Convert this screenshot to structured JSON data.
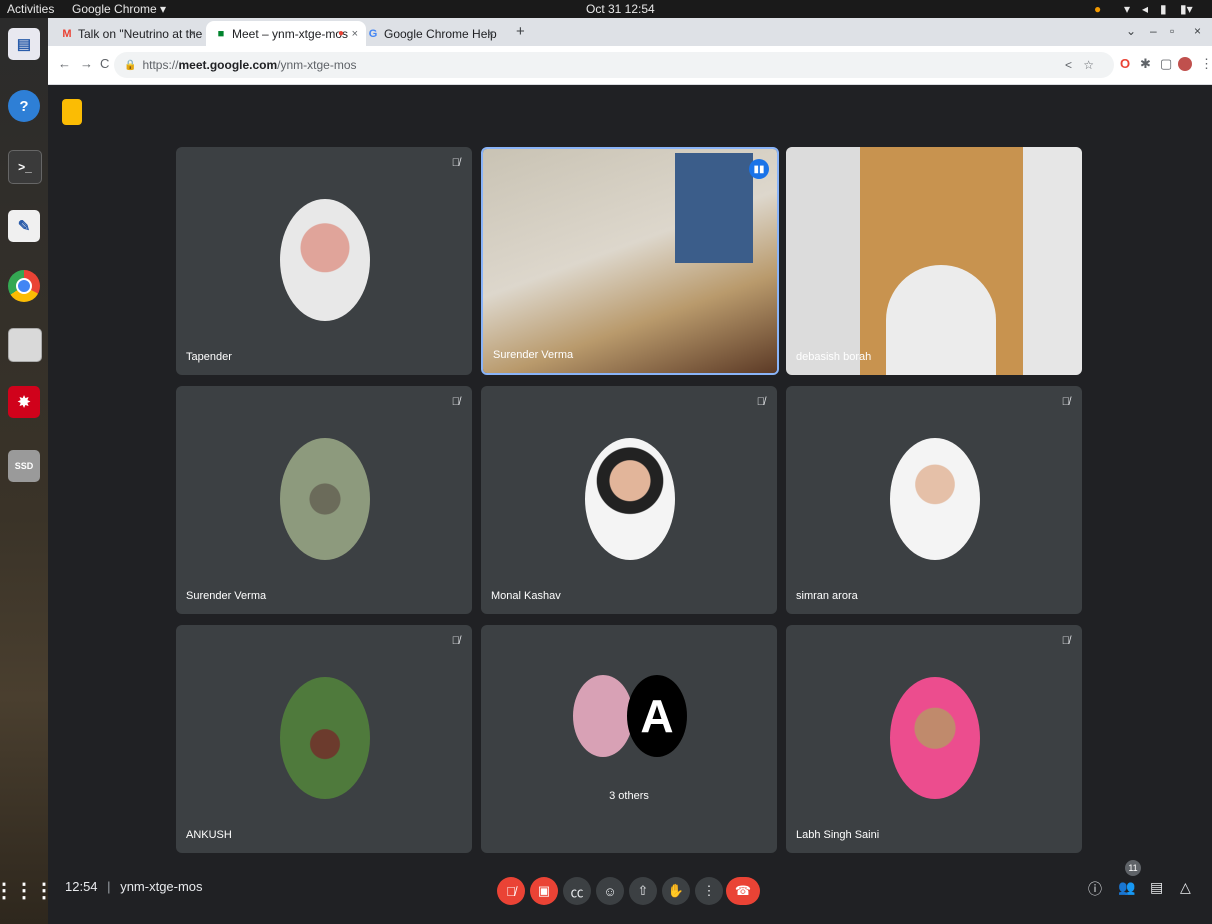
{
  "os": {
    "activities": "Activities",
    "app_menu": "Google Chrome ▾",
    "clock": "Oct 31  12:54"
  },
  "tabs": [
    {
      "label": "Talk on \"Neutrino at the",
      "favicon": "gmail-icon"
    },
    {
      "label": "Meet – ynm-xtge-mos",
      "favicon": "meet-icon"
    },
    {
      "label": "Google Chrome Help",
      "favicon": "google-icon"
    }
  ],
  "address": {
    "url_prefix": "https://",
    "url_host": "meet.google.com",
    "url_path": "/ynm-xtge-mos"
  },
  "tiles": [
    {
      "name": "Tapender",
      "muted": true
    },
    {
      "name": "Surender Verma",
      "muted": false,
      "speaking": true
    },
    {
      "name": "debasish borah",
      "muted": false
    },
    {
      "name": "Surender Verma",
      "muted": true
    },
    {
      "name": "Monal Kashav",
      "muted": true
    },
    {
      "name": "simran arora",
      "muted": true
    },
    {
      "name": "ANKUSH",
      "muted": true
    },
    {
      "name": "",
      "others_label": "3 others"
    },
    {
      "name": "Labh Singh Saini",
      "muted": true
    }
  ],
  "bottom": {
    "time": "12:54",
    "separator": "|",
    "meeting_code": "ynm-xtge-mos",
    "participants_count": "11"
  },
  "colors": {
    "red": "#ea4335",
    "tile": "#3c4043",
    "bg": "#202124",
    "speaking": "#8ab4f8"
  }
}
